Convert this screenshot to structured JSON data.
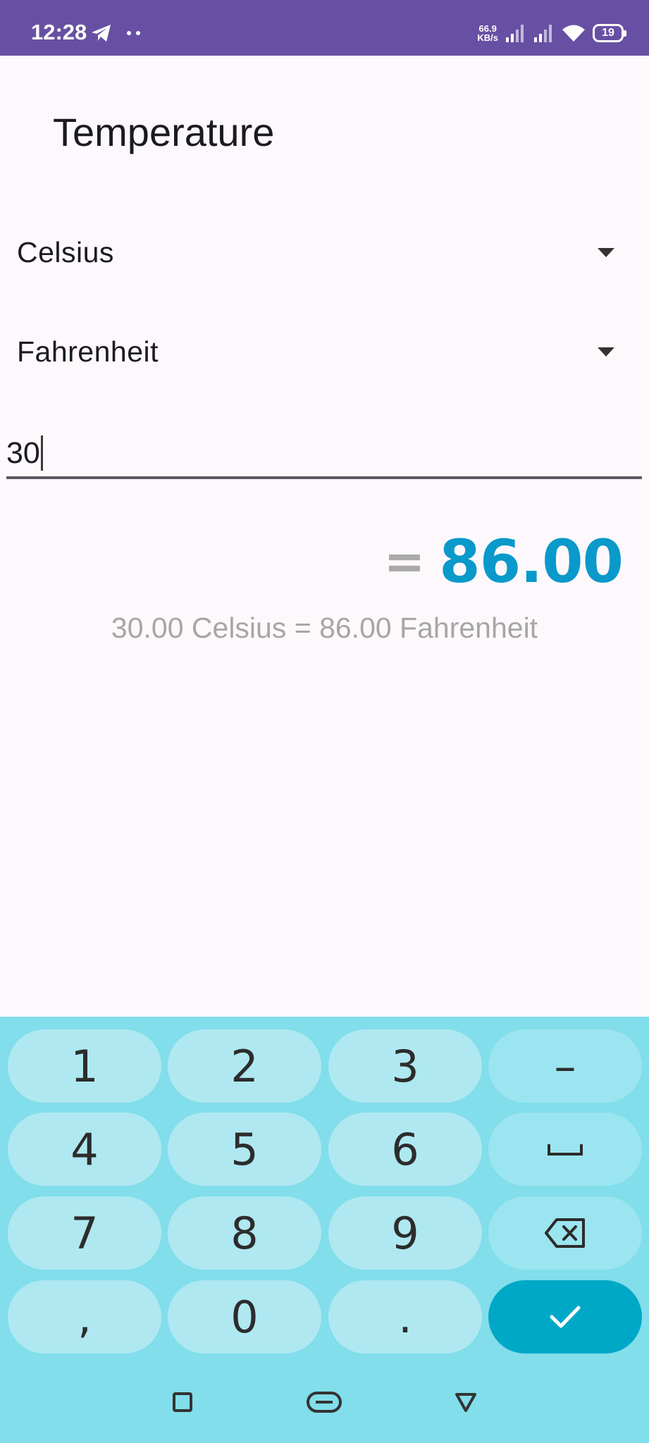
{
  "status_bar": {
    "time": "12:28",
    "net_speed_value": "66.9",
    "net_speed_unit": "KB/s",
    "battery": "19"
  },
  "page": {
    "title": "Temperature"
  },
  "from_unit": {
    "selected": "Celsius"
  },
  "to_unit": {
    "selected": "Fahrenheit"
  },
  "input": {
    "value": "30"
  },
  "result": {
    "equals": "=",
    "value": "86.00",
    "detail": "30.00 Celsius = 86.00 Fahrenheit"
  },
  "keyboard": {
    "keys": [
      "1",
      "2",
      "3",
      "–",
      "4",
      "5",
      "6",
      "␣",
      "7",
      "8",
      "9",
      "backspace",
      ",",
      "0",
      ".",
      "done"
    ],
    "row1": [
      "1",
      "2",
      "3"
    ],
    "minus_label": "–",
    "row2": [
      "4",
      "5",
      "6"
    ],
    "row3": [
      "7",
      "8",
      "9"
    ],
    "comma_label": ",",
    "zero_label": "0",
    "period_label": "."
  },
  "colors": {
    "status_bar": "#6750a4",
    "background": "#fdf8fc",
    "result_accent": "#0a99cb",
    "keyboard_bg": "#81deea",
    "key_bg": "#afe8f1",
    "enter_key": "#00a8c7"
  },
  "icons": {
    "telegram": "telegram-icon",
    "signal": "signal-icon",
    "wifi": "wifi-icon",
    "battery": "battery-icon",
    "dropdown": "dropdown-arrow-icon",
    "space": "space-icon",
    "backspace": "backspace-icon",
    "enter": "checkmark-icon",
    "recents": "square-icon",
    "home": "home-pill-icon",
    "back": "back-triangle-icon"
  }
}
